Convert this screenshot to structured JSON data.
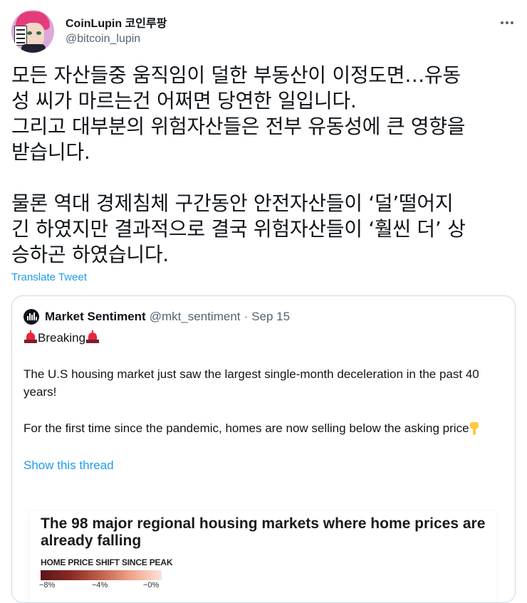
{
  "author": {
    "display_name": "CoinLupin 코인루팡",
    "handle": "@bitcoin_lupin"
  },
  "tweet": {
    "paragraph1": [
      "모든 자산들중 움직임이 덜한 부동산이 이정도면…유동",
      "성 씨가 마르는건 어쩌면 당연한 일입니다.",
      "그리고 대부분의 위험자산들은 전부 유동성에 큰 영향을",
      "받습니다."
    ],
    "paragraph2": [
      "물론 역대 경제침체 구간동안 안전자산들이 ‘덜’떨어지",
      "긴 하였지만 결과적으로 결국 위험자산들이 ‘훨씬 더’ 상",
      "승하곤 하였습니다."
    ],
    "translate_label": "Translate Tweet"
  },
  "quote": {
    "name": "Market Sentiment",
    "handle": "@mkt_sentiment",
    "separator": "·",
    "date": "Sep 15",
    "breaking": "Breaking",
    "line1": "The U.S housing market just saw the largest single-month deceleration in the past 40 years!",
    "line2": "For the first time since the pandemic, homes are now selling below the asking price",
    "show_thread": "Show this thread"
  },
  "chart_data": {
    "type": "heatmap",
    "title": "The 98 major regional housing markets where home prices are already falling",
    "legend_title": "HOME PRICE SHIFT SINCE PEAK",
    "tick_labels": [
      "−8%",
      "−4%",
      "−0%"
    ],
    "scale": [
      -8,
      0
    ],
    "colors": [
      "#5b1418",
      "#fbe3d8"
    ]
  },
  "icons": {
    "more": "more-horizontal-icon",
    "siren": "police-light-icon",
    "pointing": "backhand-index-pointing-down-icon"
  }
}
